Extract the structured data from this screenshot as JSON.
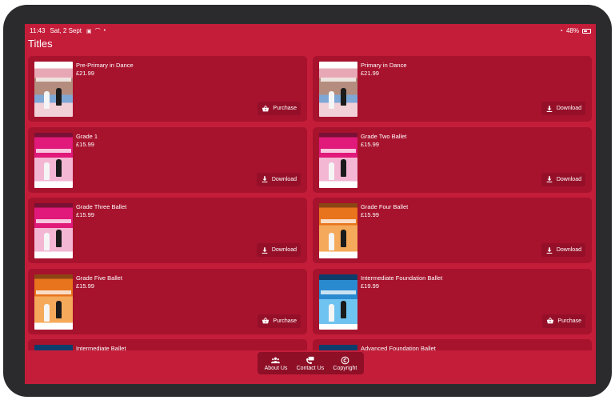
{
  "status_bar": {
    "time": "11:43",
    "date": "Sat, 2 Sept",
    "battery": "48%"
  },
  "page": {
    "title": "Titles"
  },
  "titles": [
    {
      "name": "Pre-Primary in Dance",
      "price": "£21.99",
      "action": "Purchase",
      "action_icon": "basket-icon",
      "cover": "primary"
    },
    {
      "name": "Primary in Dance",
      "price": "£21.99",
      "action": "Download",
      "action_icon": "download-icon",
      "cover": "primary"
    },
    {
      "name": "Grade 1",
      "price": "£15.99",
      "action": "Download",
      "action_icon": "download-icon",
      "cover": "pink"
    },
    {
      "name": "Grade Two Ballet",
      "price": "£15.99",
      "action": "Download",
      "action_icon": "download-icon",
      "cover": "pink"
    },
    {
      "name": "Grade Three Ballet",
      "price": "£15.99",
      "action": "Download",
      "action_icon": "download-icon",
      "cover": "pink"
    },
    {
      "name": "Grade Four Ballet",
      "price": "£15.99",
      "action": "Download",
      "action_icon": "download-icon",
      "cover": "orange"
    },
    {
      "name": "Grade Five Ballet",
      "price": "£15.99",
      "action": "Purchase",
      "action_icon": "basket-icon",
      "cover": "orange"
    },
    {
      "name": "Intermediate Foundation Ballet",
      "price": "£19.99",
      "action": "Purchase",
      "action_icon": "basket-icon",
      "cover": "blue"
    },
    {
      "name": "Intermediate Ballet",
      "price": "",
      "action": "",
      "action_icon": "",
      "cover": "blue"
    },
    {
      "name": "Advanced Foundation Ballet",
      "price": "",
      "action": "",
      "action_icon": "",
      "cover": "blue"
    }
  ],
  "bottom_nav": {
    "about_label": "About Us",
    "contact_label": "Contact Us",
    "copyright_label": "Copyright"
  },
  "colors": {
    "background": "#c41d3a",
    "card": "#a7122d",
    "button": "#950f28",
    "nav": "#8e0f26"
  }
}
